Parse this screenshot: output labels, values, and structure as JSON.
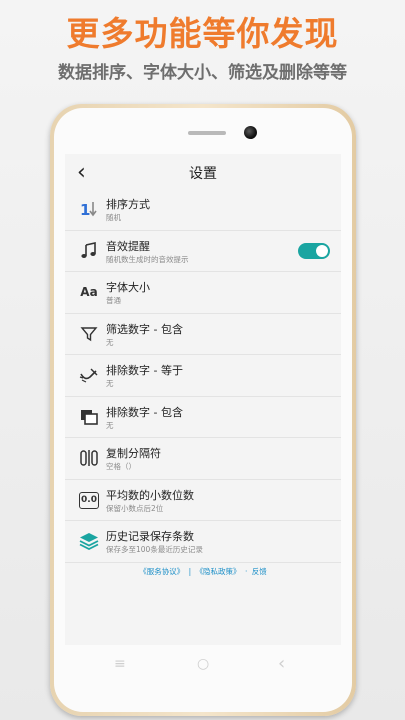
{
  "promo": {
    "headline": "更多功能等你发现",
    "subline": "数据排序、字体大小、筛选及删除等等"
  },
  "header": {
    "back_glyph": "‹",
    "title": "设置"
  },
  "settings": [
    {
      "icon": "sort-icon",
      "label": "排序方式",
      "sub": "随机"
    },
    {
      "icon": "music-note-icon",
      "label": "音效提醒",
      "sub": "随机数生成时的音效提示",
      "toggle": true
    },
    {
      "icon": "font-size-icon",
      "label": "字体大小",
      "sub": "普通",
      "glyph": "Aa"
    },
    {
      "icon": "filter-icon",
      "label": "筛选数字 - 包含",
      "sub": "无"
    },
    {
      "icon": "eraser-icon",
      "label": "排除数字 - 等于",
      "sub": "无"
    },
    {
      "icon": "exclude-overlap-icon",
      "label": "排除数字 - 包含",
      "sub": "无"
    },
    {
      "icon": "separator-icon",
      "label": "复制分隔符",
      "sub": "空格（）"
    },
    {
      "icon": "decimal-icon",
      "label": "平均数的小数位数",
      "sub": "保留小数点后2位",
      "glyph": "0.0"
    },
    {
      "icon": "layers-icon",
      "label": "历史记录保存条数",
      "sub": "保存多至100条最近历史记录"
    }
  ],
  "footer_links": {
    "service": "《服务协议》",
    "sep": "|",
    "privacy": "《隐私政策》",
    "dot": "·",
    "feedback": "反馈"
  },
  "navbar": {
    "menu_glyph": "≡",
    "home_glyph": "○",
    "back_glyph": "‹"
  },
  "colors": {
    "headline": "#ef7b2d",
    "accent": "#1aa5a1",
    "link": "#1e90c8"
  }
}
